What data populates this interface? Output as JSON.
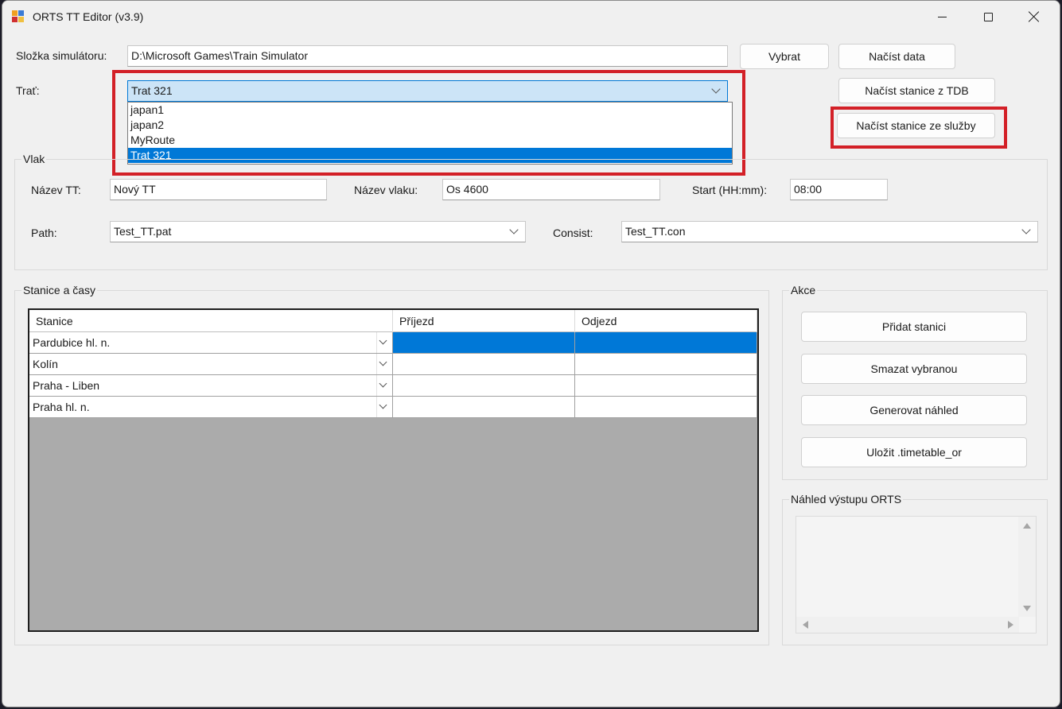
{
  "window": {
    "title": "ORTS TT Editor (v3.9)"
  },
  "colors": {
    "accent": "#0078d7",
    "highlight": "#d32027"
  },
  "icons": {
    "app": "app-icon",
    "minimize": "minimize-icon",
    "maximize": "maximize-icon",
    "close": "close-icon"
  },
  "sim": {
    "label": "Složka simulátoru:",
    "path": "D:\\Microsoft Games\\Train Simulator",
    "browse_button": "Vybrat",
    "load_button": "Načíst data"
  },
  "route": {
    "label": "Trať:",
    "selected": "Trat 321",
    "options": [
      "japan1",
      "japan2",
      "MyRoute",
      "Trat 321"
    ],
    "selected_index": 3
  },
  "actions_top": {
    "load_tdb": "Načíst stanice z TDB",
    "load_service": "Načíst stanice ze služby"
  },
  "train": {
    "group_title": "Vlak",
    "tt_name_label": "Název TT:",
    "tt_name": "Nový TT",
    "train_name_label": "Název vlaku:",
    "train_name": "Os 4600",
    "start_label": "Start (HH:mm):",
    "start": "08:00",
    "path_label": "Path:",
    "path": "Test_TT.pat",
    "consist_label": "Consist:",
    "consist": "Test_TT.con"
  },
  "stations": {
    "group_title": "Stanice a časy",
    "columns": [
      "Stanice",
      "Příjezd",
      "Odjezd"
    ],
    "rows": [
      {
        "station": "Pardubice hl. n.",
        "arrival": "",
        "departure": ""
      },
      {
        "station": "Kolín",
        "arrival": "",
        "departure": ""
      },
      {
        "station": "Praha - Liben",
        "arrival": "",
        "departure": ""
      },
      {
        "station": "Praha hl. n.",
        "arrival": "",
        "departure": ""
      }
    ]
  },
  "actions": {
    "group_title": "Akce",
    "add_station": "Přidat stanici",
    "delete_selected": "Smazat vybranou",
    "generate_preview": "Generovat náhled",
    "save": "Uložit .timetable_or"
  },
  "preview": {
    "group_title": "Náhled výstupu ORTS",
    "text": ""
  }
}
